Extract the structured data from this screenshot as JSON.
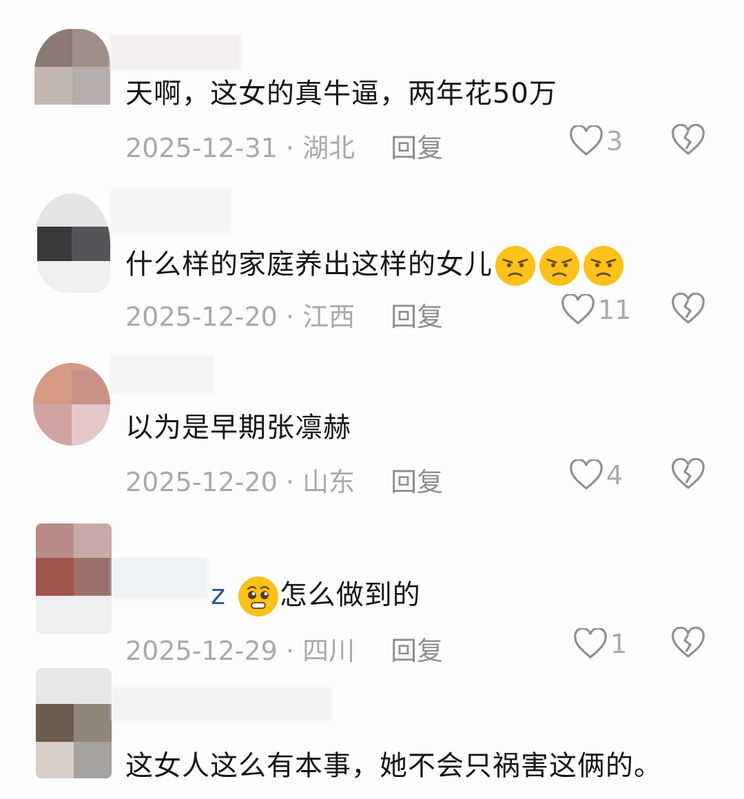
{
  "comments": [
    {
      "text": "天啊，这女的真牛逼，两年花50万",
      "date": "2025-12-31",
      "location": "湖北",
      "reply_label": "回复",
      "likes": "3"
    },
    {
      "text": "什么样的家庭养出这样的女儿",
      "date": "2025-12-20",
      "location": "江西",
      "reply_label": "回复",
      "likes": "11"
    },
    {
      "text": "以为是早期张凛赫",
      "date": "2025-12-20",
      "location": "山东",
      "reply_label": "回复",
      "likes": "4"
    },
    {
      "nick_visible": "z",
      "text": "怎么做到的",
      "date": "2025-12-29",
      "location": "四川",
      "reply_label": "回复",
      "likes": "1"
    },
    {
      "text": "这女人这么有本事，她不会只祸害这俩的。",
      "date": "",
      "location": "",
      "reply_label": "",
      "likes": ""
    }
  ],
  "separator": " · ",
  "icons": {
    "like": "heart-outline-icon",
    "dislike": "broken-heart-icon",
    "emoji_frown": "grimace-emoji-icon",
    "emoji_plead": "pleading-emoji-icon"
  },
  "colors": {
    "text": "#161616",
    "meta": "#a9a9a9",
    "icon": "#8f8f8f",
    "nick": "#2a5b90",
    "emoji": "#fcc21b"
  }
}
